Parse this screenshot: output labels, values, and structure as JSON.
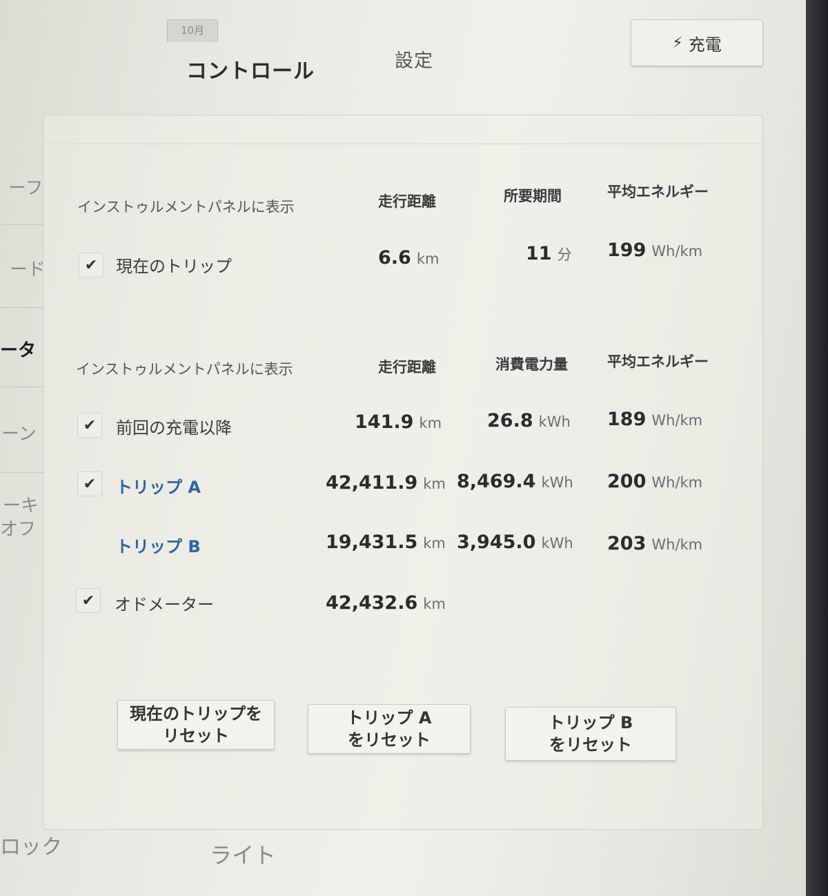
{
  "calendar_tab": "10月",
  "tabs": {
    "controls": "コントロール",
    "settings": "設定"
  },
  "charge_button": {
    "icon": "bolt-icon",
    "label": "充電"
  },
  "sidebar": {
    "items": [
      "ーフ",
      "ード",
      "ータ",
      "ーン",
      "ーキ",
      "オフ",
      "ロック"
    ]
  },
  "section1": {
    "header": "インストゥルメントパネルに表示",
    "columns": [
      "走行距離",
      "所要期間",
      "平均エネルギー"
    ],
    "rows": [
      {
        "name": "現在のトリップ",
        "checked": true,
        "distance": "6.6",
        "distance_unit": "km",
        "duration": "11",
        "duration_unit": "分",
        "energy": "199",
        "energy_unit": "Wh/km"
      }
    ]
  },
  "section2": {
    "header": "インストゥルメントパネルに表示",
    "columns": [
      "走行距離",
      "消費電力量",
      "平均エネルギー"
    ],
    "rows": [
      {
        "name": "前回の充電以降",
        "checked": true,
        "distance": "141.9",
        "distance_unit": "km",
        "consumption": "26.8",
        "consumption_unit": "kWh",
        "energy": "189",
        "energy_unit": "Wh/km"
      },
      {
        "name": "トリップ A",
        "checked": true,
        "distance": "42,411.9",
        "distance_unit": "km",
        "consumption": "8,469.4",
        "consumption_unit": "kWh",
        "energy": "200",
        "energy_unit": "Wh/km"
      },
      {
        "name": "トリップ B",
        "checked": false,
        "distance": "19,431.5",
        "distance_unit": "km",
        "consumption": "3,945.0",
        "consumption_unit": "kWh",
        "energy": "203",
        "energy_unit": "Wh/km"
      },
      {
        "name": "オドメーター",
        "checked": true,
        "distance": "42,432.6",
        "distance_unit": "km"
      }
    ]
  },
  "buttons": {
    "reset_current": [
      "現在のトリップを",
      "リセット"
    ],
    "reset_a": [
      "トリップ A",
      "をリセット"
    ],
    "reset_b": [
      "トリップ B",
      "をリセット"
    ]
  },
  "bottom_nav": {
    "lights": "ライト"
  },
  "check_glyph": "✔"
}
